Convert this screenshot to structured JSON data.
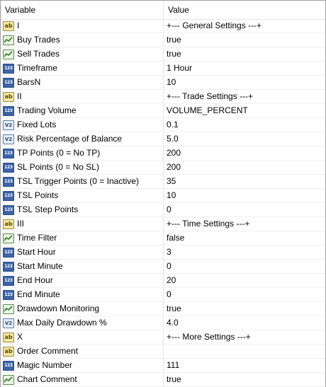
{
  "header": {
    "variable": "Variable",
    "value": "Value"
  },
  "rows": [
    {
      "icon": "string-icon",
      "type": "ab",
      "name": "I",
      "value": "+--- General Settings ---+"
    },
    {
      "icon": "bool-icon",
      "type": "bool",
      "name": "Buy Trades",
      "value": "true"
    },
    {
      "icon": "bool-icon",
      "type": "bool",
      "name": "Sell Trades",
      "value": "true"
    },
    {
      "icon": "int-icon",
      "type": "int",
      "name": "Timeframe",
      "value": "1 Hour"
    },
    {
      "icon": "int-icon",
      "type": "int",
      "name": "BarsN",
      "value": "10"
    },
    {
      "icon": "string-icon",
      "type": "ab",
      "name": "II",
      "value": "+--- Trade Settings ---+"
    },
    {
      "icon": "int-icon",
      "type": "int",
      "name": "Trading Volume",
      "value": "VOLUME_PERCENT"
    },
    {
      "icon": "double-icon",
      "type": "dbl",
      "name": "Fixed Lots",
      "value": "0.1"
    },
    {
      "icon": "double-icon",
      "type": "dbl",
      "name": "Risk Percentage of Balance",
      "value": "5.0"
    },
    {
      "icon": "int-icon",
      "type": "int",
      "name": "TP Points (0 = No TP)",
      "value": "200"
    },
    {
      "icon": "int-icon",
      "type": "int",
      "name": "SL Points (0 = No SL)",
      "value": "200"
    },
    {
      "icon": "int-icon",
      "type": "int",
      "name": "TSL Trigger Points (0 = Inactive)",
      "value": "35"
    },
    {
      "icon": "int-icon",
      "type": "int",
      "name": "TSL Points",
      "value": "10"
    },
    {
      "icon": "int-icon",
      "type": "int",
      "name": "TSL Step Points",
      "value": "0"
    },
    {
      "icon": "string-icon",
      "type": "ab",
      "name": "III",
      "value": "+--- Time Settings ---+"
    },
    {
      "icon": "bool-icon",
      "type": "bool",
      "name": "Time Filter",
      "value": "false"
    },
    {
      "icon": "int-icon",
      "type": "int",
      "name": "Start Hour",
      "value": "3"
    },
    {
      "icon": "int-icon",
      "type": "int",
      "name": "Start Minute",
      "value": "0"
    },
    {
      "icon": "int-icon",
      "type": "int",
      "name": "End Hour",
      "value": "20"
    },
    {
      "icon": "int-icon",
      "type": "int",
      "name": "End Minute",
      "value": "0"
    },
    {
      "icon": "bool-icon",
      "type": "bool",
      "name": "Drawdown Monitoring",
      "value": "true"
    },
    {
      "icon": "double-icon",
      "type": "dbl",
      "name": "Max Daily Drawdown %",
      "value": "4.0"
    },
    {
      "icon": "string-icon",
      "type": "ab",
      "name": "X",
      "value": "+--- More Settings ---+"
    },
    {
      "icon": "string-icon",
      "type": "ab",
      "name": "Order Comment",
      "value": ""
    },
    {
      "icon": "int-icon",
      "type": "int",
      "name": "Magic Number",
      "value": "111"
    },
    {
      "icon": "bool-icon",
      "type": "bool",
      "name": "Chart Comment",
      "value": "true"
    }
  ]
}
